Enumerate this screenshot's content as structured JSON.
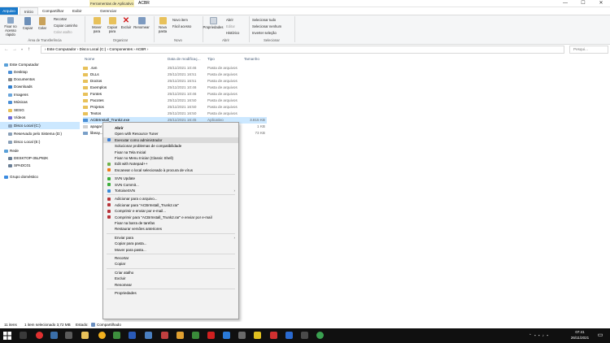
{
  "window": {
    "title": "ACBR",
    "context_tab": "Ferramentas de Aplicativo",
    "minimize": "—",
    "maximize": "☐",
    "close": "✕"
  },
  "ribbon_tabs": [
    "Arquivo",
    "Início",
    "Compartilhar",
    "Exibir",
    "Gerenciar"
  ],
  "ribbon": {
    "pin_label": "Fixar no Acesso rápido",
    "copy_label": "Copiar",
    "paste_label": "Colar",
    "recortar": "Recortar",
    "copiar_caminho": "Copiar caminho",
    "colar_atalho": "Colar atalho",
    "clipboard_group": "Área de Transferência",
    "mover_para": "Mover para",
    "copiar_para": "Copiar para",
    "excluir": "Excluir",
    "renomear": "Renomear",
    "organizar_group": "Organizar",
    "nova_pasta": "Nova pasta",
    "novo_item": "Novo item",
    "facil_acesso": "Fácil acesso",
    "novo_group": "Novo",
    "propriedades": "Propriedades",
    "abrir": "Abrir",
    "editar": "Editar",
    "historico": "Histórico",
    "abrir_group": "Abrir",
    "selecionar_tudo": "Selecionar tudo",
    "selecionar_nenhum": "Selecionar nenhum",
    "inverter_selecao": "Inverter seleção",
    "selecionar_group": "Selecionar"
  },
  "address": {
    "path": "›  Este Computador  ›  Disco Local (C:)  ›  Componentes  ›  ACBR  ›",
    "search_placeholder": "Pesqui..."
  },
  "nav_pane": [
    {
      "label": "Este Computador",
      "color": "#5aa0d8"
    },
    {
      "label": "Desktop",
      "color": "#4c8fd6"
    },
    {
      "label": "Documentos",
      "color": "#8a8a8a"
    },
    {
      "label": "Downloads",
      "color": "#2f7fd0"
    },
    {
      "label": "Imagens",
      "color": "#6aa6dc"
    },
    {
      "label": "Músicas",
      "color": "#4c8fd6"
    },
    {
      "label": "SESG",
      "color": "#e8c15a"
    },
    {
      "label": "Vídeos",
      "color": "#6b6bd8"
    },
    {
      "label": "Disco Local (C:)",
      "color": "#8aa0b8"
    },
    {
      "label": "Reservado pelo Sistema (D:)",
      "color": "#8aa0b8"
    },
    {
      "label": "Disco Local (E:)",
      "color": "#8aa0b8"
    },
    {
      "label": "Rede",
      "color": "#5aa0d8"
    },
    {
      "label": "DESKTOP-35LP82K",
      "color": "#6a7f96"
    },
    {
      "label": "SPADC01",
      "color": "#6a7f96"
    },
    {
      "label": "Grupo doméstico",
      "color": "#3b8be0"
    }
  ],
  "columns": {
    "name": "Nome",
    "date": "Data de modificaç...",
    "type": "Tipo",
    "size": "Tamanho"
  },
  "files": [
    {
      "name": ".svn",
      "date": "25/11/2021 10:46",
      "type": "Pasta de arquivos",
      "size": ""
    },
    {
      "name": "DLLs",
      "date": "25/11/2021 16:51",
      "type": "Pasta de arquivos",
      "size": ""
    },
    {
      "name": "Doctos",
      "date": "25/11/2021 16:51",
      "type": "Pasta de arquivos",
      "size": ""
    },
    {
      "name": "Exemplos",
      "date": "25/11/2021 10:46",
      "type": "Pasta de arquivos",
      "size": ""
    },
    {
      "name": "Fontes",
      "date": "25/11/2021 10:46",
      "type": "Pasta de arquivos",
      "size": ""
    },
    {
      "name": "Pacotes",
      "date": "25/11/2021 16:50",
      "type": "Pasta de arquivos",
      "size": ""
    },
    {
      "name": "Projetos",
      "date": "25/11/2021 16:50",
      "type": "Pasta de arquivos",
      "size": ""
    },
    {
      "name": "Textos",
      "date": "25/11/2021 16:50",
      "type": "Pasta de arquivos",
      "size": ""
    },
    {
      "name": "ACBrInstall_Trunk2.exe",
      "date": "25/11/2021 16:45",
      "type": "Aplicativo",
      "size": "3.815 KB"
    },
    {
      "name": "apagar",
      "date": "",
      "type": "",
      "size": "1 KB"
    },
    {
      "name": "libeay...",
      "date": "",
      "type": "",
      "size": "73 KB"
    }
  ],
  "context_menu": [
    {
      "label": "Abrir",
      "bold": true
    },
    {
      "label": "Open with Resource Tuner"
    },
    {
      "label": "Executar como administrador",
      "icon": "#3a7fd8",
      "highlight": true
    },
    {
      "label": "Solucionar problemas de compatibilidade"
    },
    {
      "label": "Fixar na Tela Inicial"
    },
    {
      "label": "Fixar no Menu Iniciar (Classic Shell)"
    },
    {
      "label": "Edit with Notepad++",
      "icon": "#6fb24a"
    },
    {
      "label": "Escanear o local selecionado à procura de vírus",
      "icon": "#f07a1a"
    },
    {
      "sep": true
    },
    {
      "label": "SVN Update",
      "icon": "#3cae3c"
    },
    {
      "label": "SVN Commit...",
      "icon": "#3cae3c"
    },
    {
      "label": "TortoiseSVN",
      "icon": "#3a8ad8",
      "submenu": true
    },
    {
      "sep": true
    },
    {
      "label": "Adicionar para o arquivo...",
      "icon": "#b8343a"
    },
    {
      "label": "Adicionar para \"ACBrInstall_Trunk2.rar\"",
      "icon": "#b8343a"
    },
    {
      "label": "Comprimir e enviar por e-mail...",
      "icon": "#b8343a"
    },
    {
      "label": "Comprimir para \"ACBrInstall_Trunk2.rar\" e enviar por e-mail",
      "icon": "#b8343a"
    },
    {
      "label": "Fixar na barra de tarefas"
    },
    {
      "label": "Restaurar versões anteriores"
    },
    {
      "sep": true
    },
    {
      "label": "Enviar para",
      "submenu": true
    },
    {
      "label": "Copiar para pasta..."
    },
    {
      "label": "Mover para pasta..."
    },
    {
      "sep": true
    },
    {
      "label": "Recortar"
    },
    {
      "label": "Copiar"
    },
    {
      "sep": true
    },
    {
      "label": "Criar atalho"
    },
    {
      "label": "Excluir"
    },
    {
      "label": "Renomear"
    },
    {
      "sep": true
    },
    {
      "label": "Propriedades"
    }
  ],
  "status": {
    "items": "11 itens",
    "selected": "1 item selecionado  3,72 MB",
    "state": "Estado:",
    "shared": "Compartilhado"
  },
  "clock": {
    "time": "07:41",
    "date": "26/11/2021"
  }
}
